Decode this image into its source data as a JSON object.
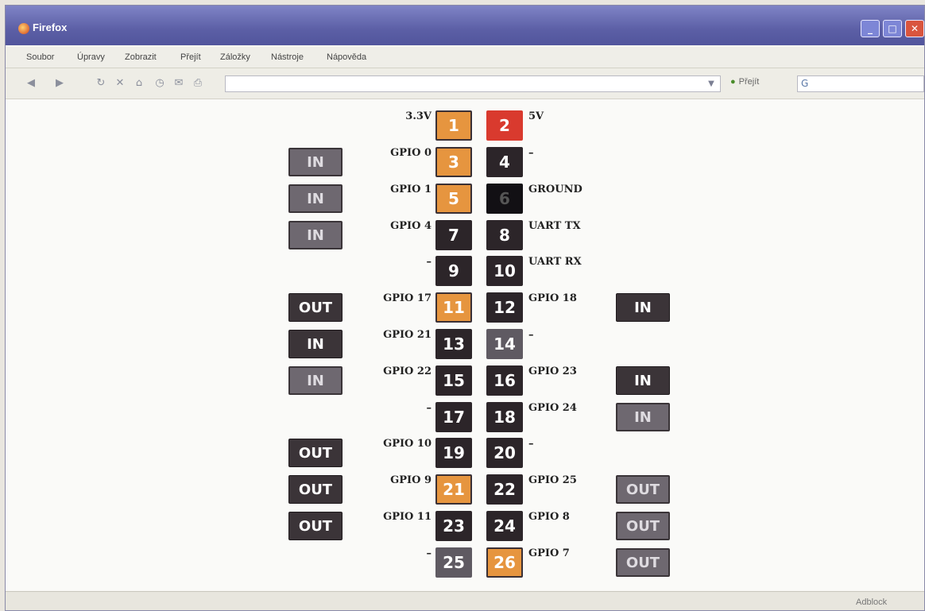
{
  "window": {
    "title": "Firefox"
  },
  "menu": [
    "Soubor",
    "Úpravy",
    "Zobrazit",
    "Přejít",
    "Záložky",
    "Nástroje",
    "Nápověda"
  ],
  "navbar": {
    "url": "",
    "go_label": "Přejít",
    "search_placeholder": ""
  },
  "status": {
    "text": "Adblock"
  },
  "colors": {
    "pin_dark": "#2c2529",
    "pin_orange": "#e6953f",
    "pin_red": "#d93a2e",
    "pin_gray": "#5f5a62",
    "title_bar": "#5c5fa6"
  },
  "header": {
    "left_label": "3.3V",
    "pin1": "1",
    "pin2": "2",
    "right_label": "5V"
  },
  "rows": [
    {
      "mode_left": "IN",
      "label_left": "GPIO 0",
      "pin_left": "3",
      "pin_right": "4",
      "label_right": "–",
      "mode_right": ""
    },
    {
      "mode_left": "IN",
      "label_left": "GPIO 1",
      "pin_left": "5",
      "pin_right": "6",
      "label_right": "GROUND",
      "mode_right": ""
    },
    {
      "mode_left": "IN",
      "label_left": "GPIO 4",
      "pin_left": "7",
      "pin_right": "8",
      "label_right": "UART TX",
      "mode_right": ""
    },
    {
      "mode_left": "",
      "label_left": "–",
      "pin_left": "9",
      "pin_right": "10",
      "label_right": "UART RX",
      "mode_right": ""
    },
    {
      "mode_left": "OUT",
      "label_left": "GPIO 17",
      "pin_left": "11",
      "pin_right": "12",
      "label_right": "GPIO 18",
      "mode_right": "IN"
    },
    {
      "mode_left": "IN",
      "label_left": "GPIO 21",
      "pin_left": "13",
      "pin_right": "14",
      "label_right": "–",
      "mode_right": ""
    },
    {
      "mode_left": "IN",
      "label_left": "GPIO 22",
      "pin_left": "15",
      "pin_right": "16",
      "label_right": "GPIO 23",
      "mode_right": "IN"
    },
    {
      "mode_left": "",
      "label_left": "–",
      "pin_left": "17",
      "pin_right": "18",
      "label_right": "GPIO 24",
      "mode_right": "IN"
    },
    {
      "mode_left": "OUT",
      "label_left": "GPIO 10",
      "pin_left": "19",
      "pin_right": "20",
      "label_right": "–",
      "mode_right": ""
    },
    {
      "mode_left": "OUT",
      "label_left": "GPIO 9",
      "pin_left": "21",
      "pin_right": "22",
      "label_right": "GPIO 25",
      "mode_right": "OUT"
    },
    {
      "mode_left": "OUT",
      "label_left": "GPIO 11",
      "pin_left": "23",
      "pin_right": "24",
      "label_right": "GPIO 8",
      "mode_right": "OUT"
    },
    {
      "mode_left": "",
      "label_left": "–",
      "pin_left": "25",
      "pin_right": "26",
      "label_right": "GPIO 7",
      "mode_right": "OUT"
    }
  ]
}
